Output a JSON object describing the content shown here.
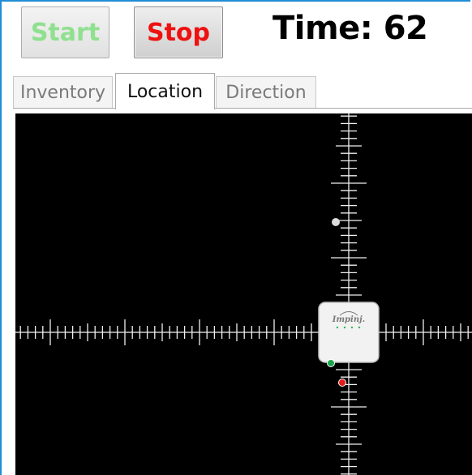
{
  "toolbar": {
    "start_label": "Start",
    "stop_label": "Stop",
    "time_label": "Time: 62"
  },
  "tabs": [
    {
      "label": "Inventory",
      "selected": false
    },
    {
      "label": "Location",
      "selected": true
    },
    {
      "label": "Direction",
      "selected": false
    }
  ],
  "reader": {
    "brand": "Impinj."
  },
  "colors": {
    "window_border": "#1f8dd6",
    "start_text": "#8fe08f",
    "stop_text": "#ee1111",
    "tag_white": "#dcdcdc",
    "tag_green": "#1aa64a",
    "tag_red": "#e51b1b"
  }
}
